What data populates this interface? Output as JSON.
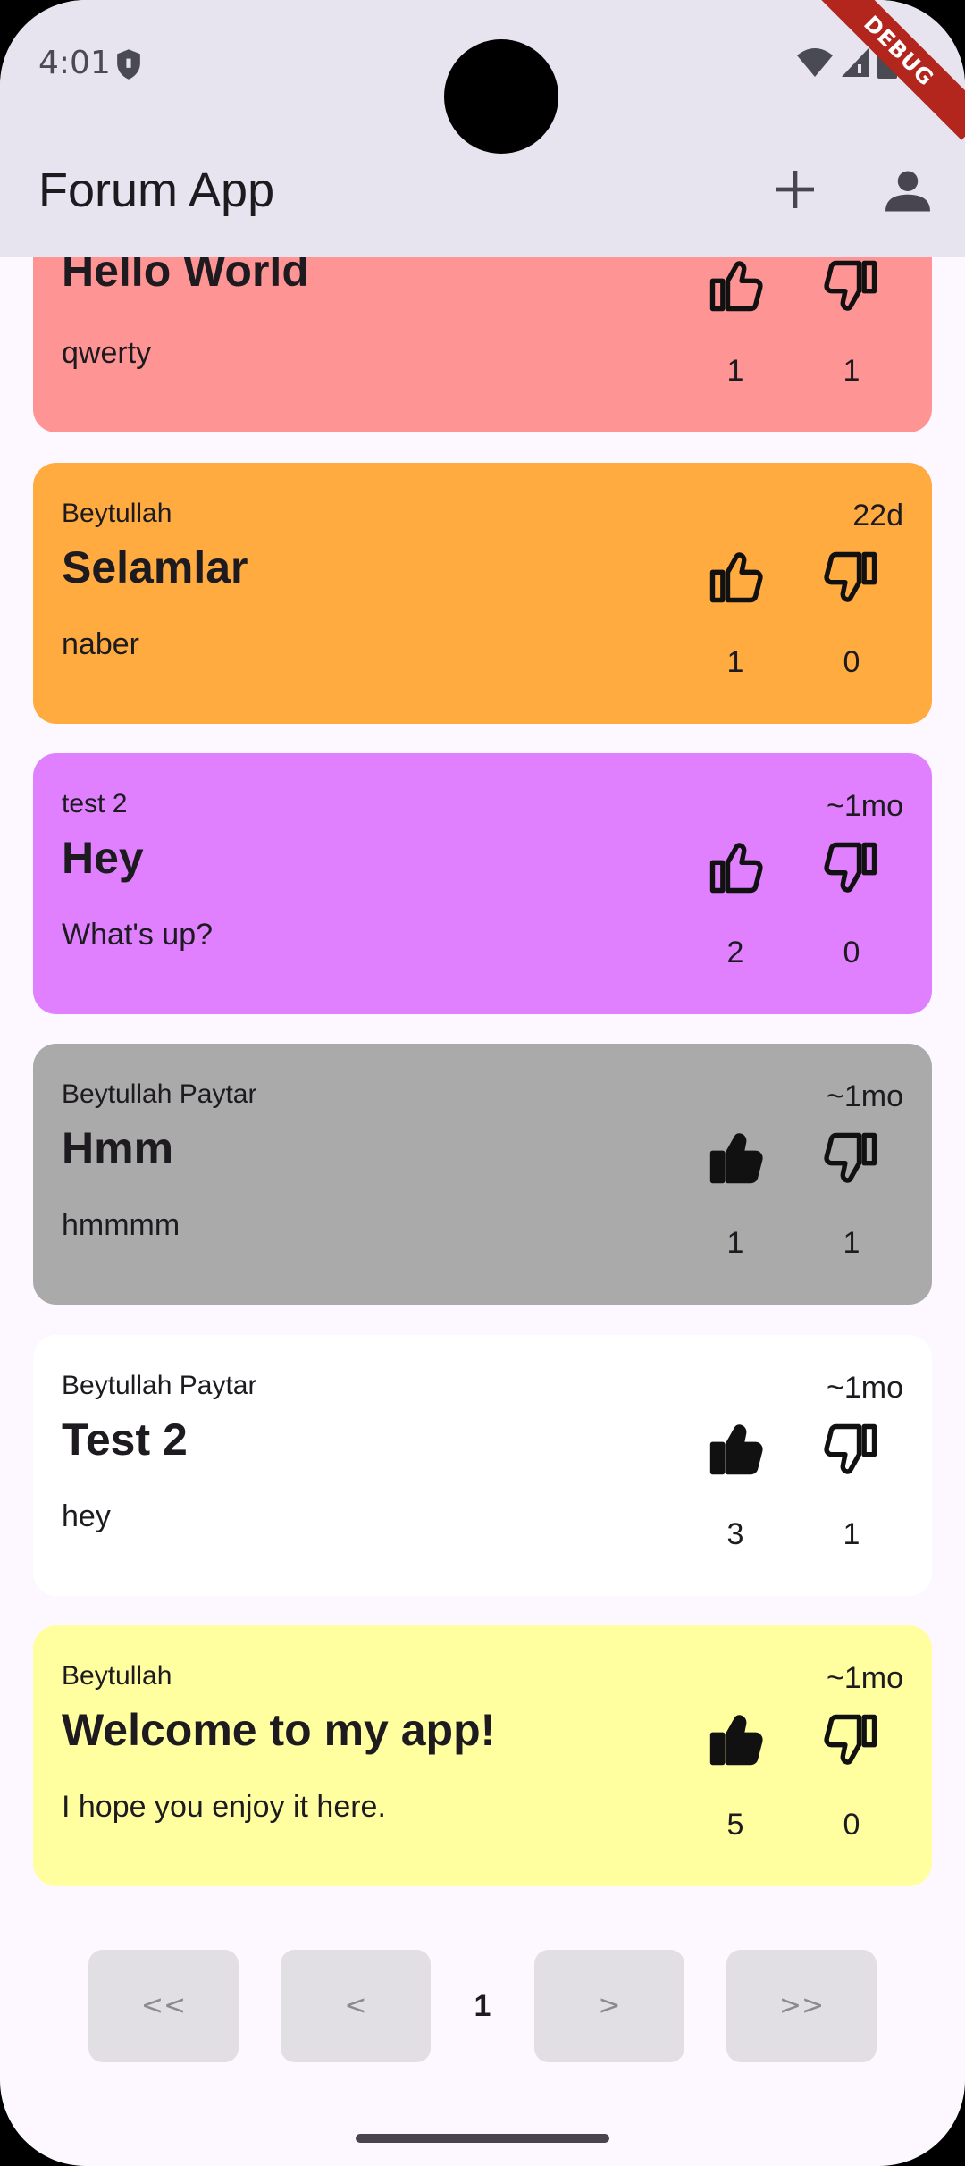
{
  "status_bar": {
    "time": "4:01",
    "debug_label": "DEBUG"
  },
  "app_bar": {
    "title": "Forum App",
    "add_icon": "plus-icon",
    "account_icon": "person-icon"
  },
  "posts": [
    {
      "author": "",
      "age": "",
      "title": "Hello World",
      "body": "qwerty",
      "likes": "1",
      "dislikes": "1",
      "color": "#ff9494",
      "liked": false
    },
    {
      "author": "Beytullah",
      "age": "22d",
      "title": "Selamlar",
      "body": "naber",
      "likes": "1",
      "dislikes": "0",
      "color": "#ffab40",
      "liked": false
    },
    {
      "author": "test 2",
      "age": "~1mo",
      "title": "Hey",
      "body": "What's up?",
      "likes": "2",
      "dislikes": "0",
      "color": "#e180ff",
      "liked": false
    },
    {
      "author": "Beytullah Paytar",
      "age": "~1mo",
      "title": "Hmm",
      "body": "hmmmm",
      "likes": "1",
      "dislikes": "1",
      "color": "#aaaaaa",
      "liked": true
    },
    {
      "author": "Beytullah Paytar",
      "age": "~1mo",
      "title": "Test 2",
      "body": "hey",
      "likes": "3",
      "dislikes": "1",
      "color": "#ffffff",
      "liked": true
    },
    {
      "author": "Beytullah",
      "age": "~1mo",
      "title": "Welcome to my app!",
      "body": "I hope you enjoy it here.",
      "likes": "5",
      "dislikes": "0",
      "color": "#ffffa0",
      "liked": true
    }
  ],
  "pagination": {
    "first": "<<",
    "prev": "<",
    "current": "1",
    "next": ">",
    "last": ">>"
  }
}
